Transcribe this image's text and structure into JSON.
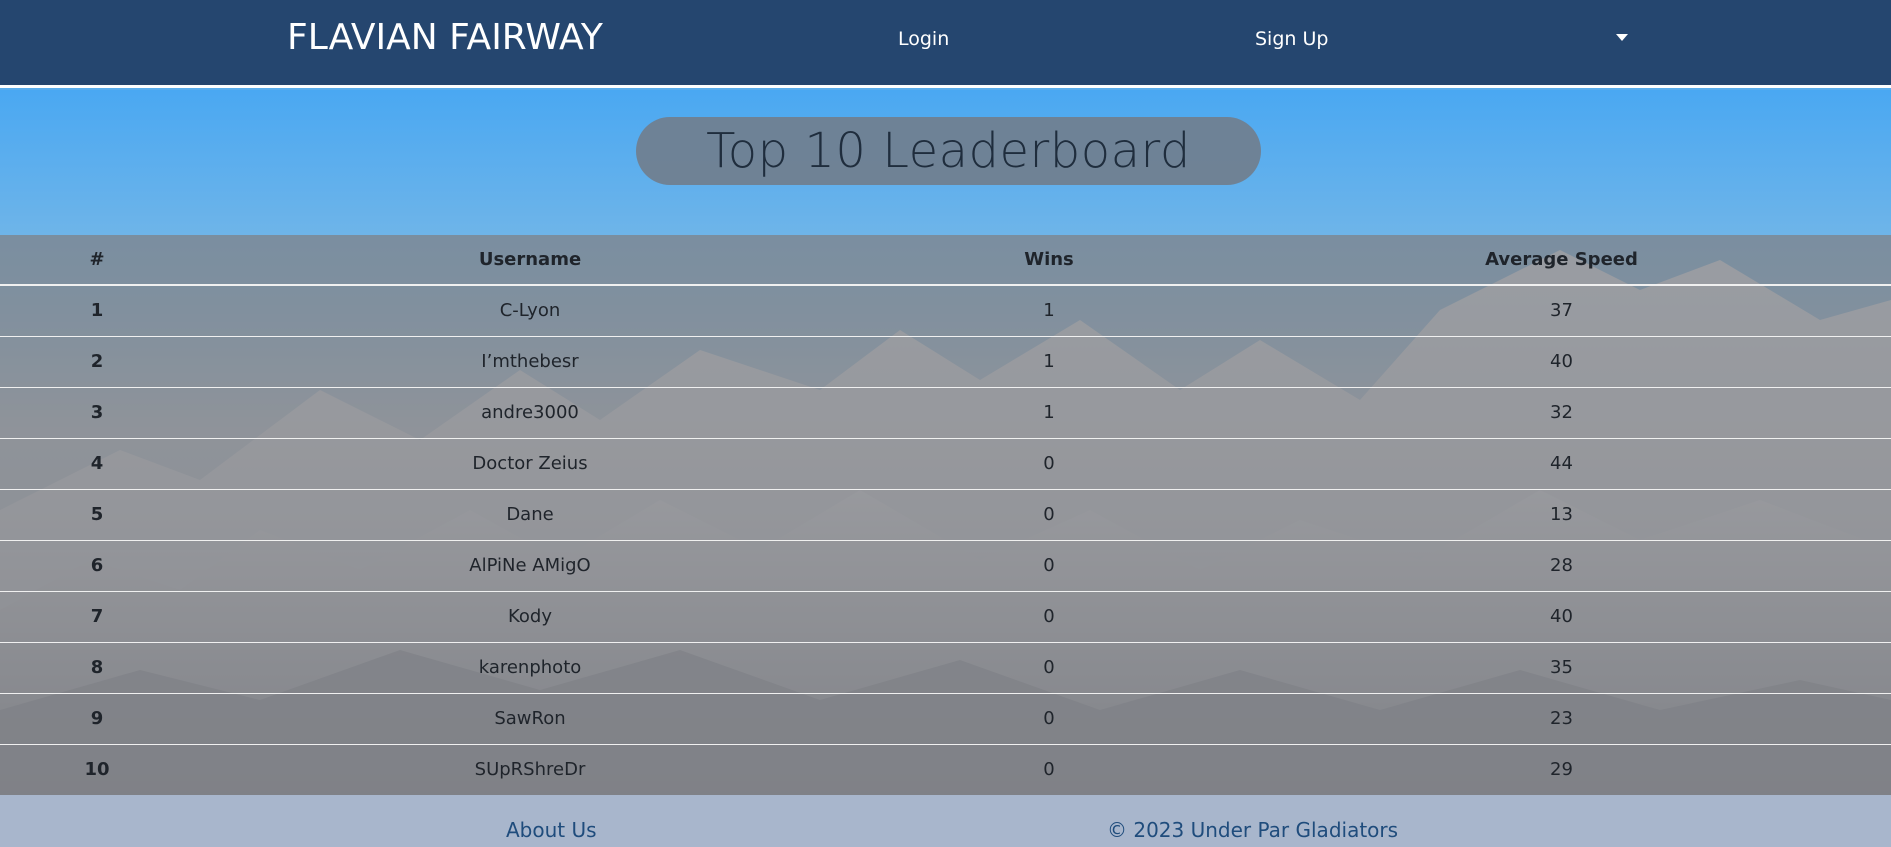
{
  "navbar": {
    "brand": "FLAVIAN FAIRWAY",
    "login_label": "Login",
    "signup_label": "Sign Up",
    "dropdown_icon": "caret-down-icon"
  },
  "main": {
    "title": "Top 10 Leaderboard"
  },
  "leaderboard": {
    "headers": [
      "#",
      "Username",
      "Wins",
      "Average Speed"
    ],
    "rows": [
      {
        "rank": "1",
        "username": "C-Lyon",
        "wins": "1",
        "speed": "37"
      },
      {
        "rank": "2",
        "username": "I’mthebesr",
        "wins": "1",
        "speed": "40"
      },
      {
        "rank": "3",
        "username": "andre3000",
        "wins": "1",
        "speed": "32"
      },
      {
        "rank": "4",
        "username": "Doctor Zeius",
        "wins": "0",
        "speed": "44"
      },
      {
        "rank": "5",
        "username": "Dane",
        "wins": "0",
        "speed": "13"
      },
      {
        "rank": "6",
        "username": "AlPiNe AMigO",
        "wins": "0",
        "speed": "28"
      },
      {
        "rank": "7",
        "username": "Kody",
        "wins": "0",
        "speed": "40"
      },
      {
        "rank": "8",
        "username": "karenphoto",
        "wins": "0",
        "speed": "35"
      },
      {
        "rank": "9",
        "username": "SawRon",
        "wins": "0",
        "speed": "23"
      },
      {
        "rank": "10",
        "username": "SUpRShreDr",
        "wins": "0",
        "speed": "29"
      }
    ]
  },
  "footer": {
    "about_label": "About Us",
    "copyright": "© 2023 Under Par Gladiators"
  },
  "colors": {
    "navbar_bg": "#25466f",
    "title_pill_bg": "#708090",
    "footer_bg": "#a8b6cc",
    "footer_text": "#1f4c7c"
  }
}
